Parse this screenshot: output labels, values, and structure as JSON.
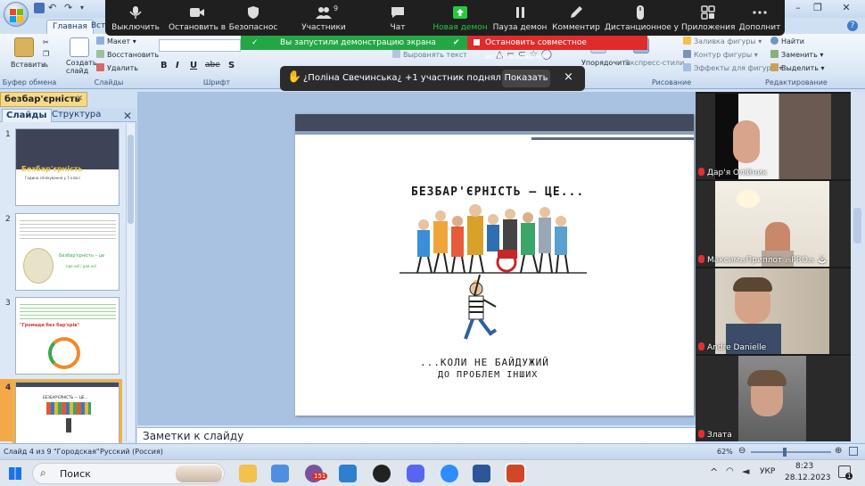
{
  "zoom": {
    "toolbar": [
      {
        "label": "Выключить",
        "icon": "microphone-icon"
      },
      {
        "label": "Остановить в",
        "icon": "video-camera-icon"
      },
      {
        "label": "Безопаснос",
        "icon": "shield-icon"
      },
      {
        "label": "Участники",
        "icon": "participants-icon",
        "count": "9"
      },
      {
        "label": "Чат",
        "icon": "chat-icon"
      },
      {
        "label": "Новая демон",
        "icon": "share-screen-icon"
      },
      {
        "label": "Пауза демон",
        "icon": "pause-icon"
      },
      {
        "label": "Комментир",
        "icon": "annotate-pen-icon"
      },
      {
        "label": "Дистанционное у",
        "icon": "remote-control-icon"
      },
      {
        "label": "Приложения",
        "icon": "apps-icon"
      },
      {
        "label": "Дополнит",
        "icon": "more-icon"
      }
    ],
    "share_notice": "Вы запустили демонстрацию экрана",
    "stop_share": "Остановить совместное использование",
    "raise_hand": {
      "text": "¿Поліна Свечинська¿ +1 участник поднял руку",
      "button": "Показать",
      "close": "×"
    },
    "participants": [
      {
        "name": "Дар'я Олійник"
      },
      {
        "name": "Максим₂₅Приплот ₂₅PRO₂₅ 🕹"
      },
      {
        "name": "Andre Danielle"
      },
      {
        "name": "Злата"
      }
    ]
  },
  "office": {
    "tabs": [
      "Главная",
      "Вста"
    ],
    "clipboard": {
      "paste": "Вставить",
      "group": "Буфер обмена"
    },
    "slides_group": {
      "create": "Создать слайд",
      "layout": "Макет",
      "reset": "Восстановить",
      "delete": "Удалить",
      "group": "Слайды"
    },
    "font_group": "Шрифт",
    "paragraph": {
      "align_text": "Выровнять текст"
    },
    "drawing": {
      "arrange": "Упорядочить",
      "quick_styles": "Экспресс-стили",
      "group": "Рисование",
      "fill": "Заливка фигуры",
      "outline": "Контур фигуры",
      "effects": "Эффекты для фигуры"
    },
    "editing": {
      "find": "Найти",
      "replace": "Заменить",
      "select": "Выделить",
      "group": "Редактирование"
    },
    "format_buttons": [
      "B",
      "I",
      "U",
      "abe",
      "S"
    ]
  },
  "panel": {
    "doc_tab": "безбар'єрність",
    "tab_slides": "Слайды",
    "tab_outline": "Структура",
    "thumbs": [
      {
        "num": "1",
        "title": "Безбар'єрність",
        "sub": "Година спілкування у 1 класі"
      },
      {
        "num": "2",
        "title": "Безбар'єрність – це",
        "sub": "про неї і для неї"
      },
      {
        "num": "3",
        "title": "\"Громади без бар'єрів\"",
        "sub": ""
      },
      {
        "num": "4",
        "title": "БЕЗБАР'ЄРНІСТЬ — ЦЕ...",
        "sub": ""
      }
    ]
  },
  "slide": {
    "title": "БЕЗБАР'ЄРНІСТЬ — ЦЕ...",
    "bottom1": "...КОЛИ НЕ БАЙДУЖИЙ",
    "bottom2": "ДО ПРОБЛЕМ ІНШИХ"
  },
  "notes": "Заметки к слайду",
  "status": {
    "slide_of": "Слайд 4 из 9",
    "theme": "\"Городская\"",
    "lang": "Русский (Россия)",
    "zoom": "62%"
  },
  "taskbar": {
    "search": "Поиск",
    "viber_badge": "151",
    "lang": "УКР",
    "time": "8:23",
    "date": "28.12.2023",
    "notif": "1"
  }
}
